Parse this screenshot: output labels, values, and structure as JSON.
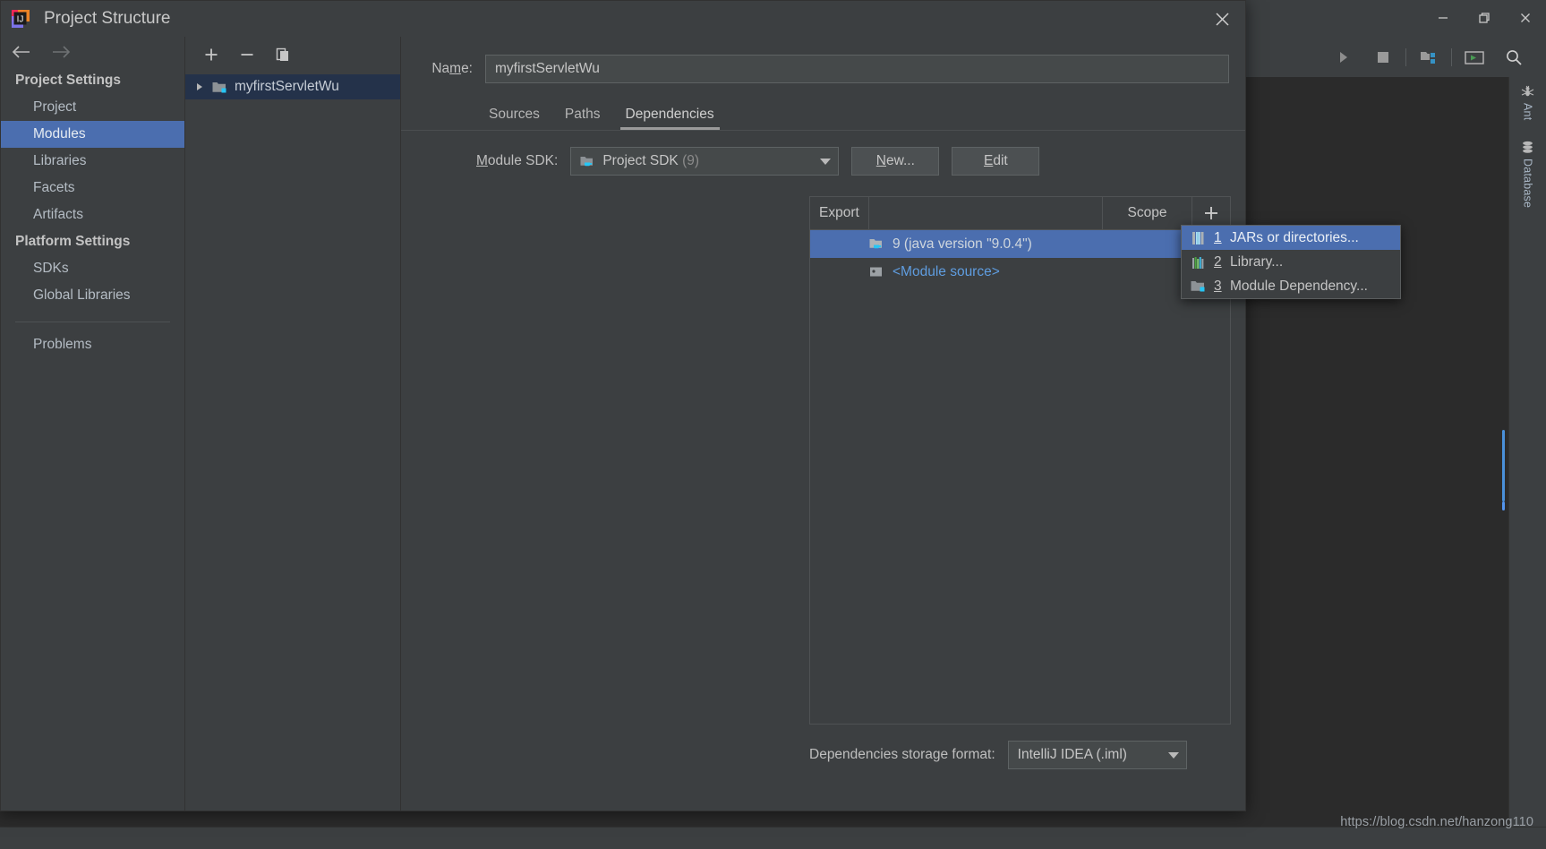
{
  "ide": {
    "window_controls": [
      "minimize",
      "restore",
      "close"
    ],
    "toolbar_icons": [
      "stop-icon",
      "project-structure-icon",
      "run-configuration-icon",
      "search-icon"
    ],
    "right_tool_buttons": [
      {
        "label": "Ant",
        "icon": "ant-icon"
      },
      {
        "label": "Database",
        "icon": "database-icon"
      }
    ],
    "watermark": "https://blog.csdn.net/hanzong110"
  },
  "dialog": {
    "title": "Project Structure",
    "logo_icon": "intellij-idea-logo",
    "close_icon": "close-icon",
    "nav": {
      "back_icon": "arrow-left-icon",
      "forward_icon": "arrow-right-icon",
      "groups": [
        {
          "label": "Project Settings",
          "items": [
            {
              "label": "Project",
              "selected": false
            },
            {
              "label": "Modules",
              "selected": true
            },
            {
              "label": "Libraries",
              "selected": false
            },
            {
              "label": "Facets",
              "selected": false
            },
            {
              "label": "Artifacts",
              "selected": false
            }
          ]
        },
        {
          "label": "Platform Settings",
          "items": [
            {
              "label": "SDKs",
              "selected": false
            },
            {
              "label": "Global Libraries",
              "selected": false
            }
          ]
        }
      ],
      "problems": {
        "label": "Problems"
      }
    },
    "tree": {
      "toolbar": [
        {
          "name": "add-module-button",
          "icon": "plus-icon"
        },
        {
          "name": "remove-module-button",
          "icon": "minus-icon"
        },
        {
          "name": "copy-module-button",
          "icon": "copy-icon"
        }
      ],
      "rows": [
        {
          "label": "myfirstServletWu",
          "icon": "module-icon",
          "expander": "triangle-right",
          "selected": true
        }
      ]
    },
    "main": {
      "name_label_pre": "Na",
      "name_label_accel": "m",
      "name_label_post": "e:",
      "name_value": "myfirstServletWu",
      "tabs": [
        {
          "label": "Sources",
          "active": false
        },
        {
          "label": "Paths",
          "active": false
        },
        {
          "label": "Dependencies",
          "active": true
        }
      ],
      "sdk_label_pre": "",
      "sdk_label_accel": "M",
      "sdk_label_post": "odule SDK:",
      "sdk_value": "Project SDK",
      "sdk_value_suffix": "(9)",
      "sdk_icon": "java-sdk-icon",
      "new_button": {
        "pre": "",
        "accel": "N",
        "post": "ew..."
      },
      "edit_button": {
        "pre": "",
        "accel": "E",
        "post": "dit"
      },
      "table": {
        "columns": [
          {
            "label": "Export",
            "key": "export"
          },
          {
            "label": "",
            "key": "name"
          },
          {
            "label": "Scope",
            "key": "scope"
          }
        ],
        "add_icon": "plus-icon",
        "rows": [
          {
            "name": "9 (java version \"9.0.4\")",
            "icon": "java-sdk-icon",
            "scope": "",
            "selected": true,
            "link": false
          },
          {
            "name": "<Module source>",
            "icon": "module-source-icon",
            "scope": "",
            "selected": false,
            "link": true
          }
        ]
      },
      "storage_format_label": "Dependencies storage format:",
      "storage_format_value": "IntelliJ IDEA (.iml)"
    },
    "popup_menu": {
      "items": [
        {
          "number": "1",
          "label": "JARs or directories...",
          "icon": "jar-icon",
          "selected": true
        },
        {
          "number": "2",
          "label": "Library...",
          "icon": "library-icon",
          "selected": false
        },
        {
          "number": "3",
          "label": "Module Dependency...",
          "icon": "module-icon",
          "selected": false
        }
      ]
    }
  },
  "colors": {
    "accent": "#4b6eaf",
    "panel": "#3c3f41",
    "editor": "#2b2b2b",
    "link": "#5f9de0",
    "text": "#bbbbbb"
  }
}
